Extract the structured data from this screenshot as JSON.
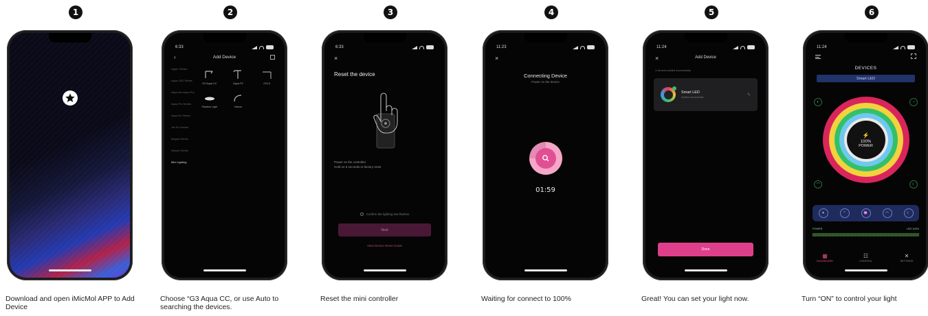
{
  "steps": [
    {
      "num": "1",
      "caption": "Download and open iMicMol APP to Add Device"
    },
    {
      "num": "2",
      "caption": "Choose “G3 Aqua CC, or use Auto to searching the devices."
    },
    {
      "num": "3",
      "caption": "Reset the mini controller"
    },
    {
      "num": "4",
      "caption": "Waiting for connect to 100%"
    },
    {
      "num": "5",
      "caption": "Great! You can set your light now."
    },
    {
      "num": "6",
      "caption": "Turn “ON” to control your light"
    }
  ],
  "screen2": {
    "time": "6:33",
    "title": "Add Device",
    "categories": [
      "Hyper Series",
      "Aqua LED Series",
      "Aqua Arc Aqua Pro",
      "Aqua Pro Series",
      "Aqua Ex Series",
      "Jet Pro Series",
      "Magna Series",
      "Wizard Series",
      "Mini Lighting"
    ],
    "products": [
      "G3 Aqua CC",
      "Aqua P2",
      "GSL3",
      "Shadow Light",
      "Nanos"
    ]
  },
  "screen3": {
    "time": "6:33",
    "title": "Reset the device",
    "note_line1": "Power on the controller",
    "note_line2": "Hold on 5 seconds to factory reset",
    "confirm": "Confirm the lighting has flashes",
    "next": "Next",
    "guide": "View Device Reset Guide"
  },
  "screen4": {
    "time": "11:23",
    "title": "Connecting Device",
    "subtitle": "Power on the device",
    "timer": "01:59"
  },
  "screen5": {
    "time": "11:24",
    "title": "Add Device",
    "subtitle": "1 devices added successfully",
    "device_name": "Smart LED",
    "device_desc": "Added successfully",
    "done": "Done"
  },
  "screen6": {
    "time": "11:24",
    "title": "DEVICES",
    "device_pill": "Smart LED",
    "percent": "100%",
    "power_label": "POWER",
    "power_left": "POWER",
    "power_right": "LED 100%",
    "nav": [
      "DASHBOARD",
      "CONTROL",
      "SETTINGS"
    ]
  }
}
